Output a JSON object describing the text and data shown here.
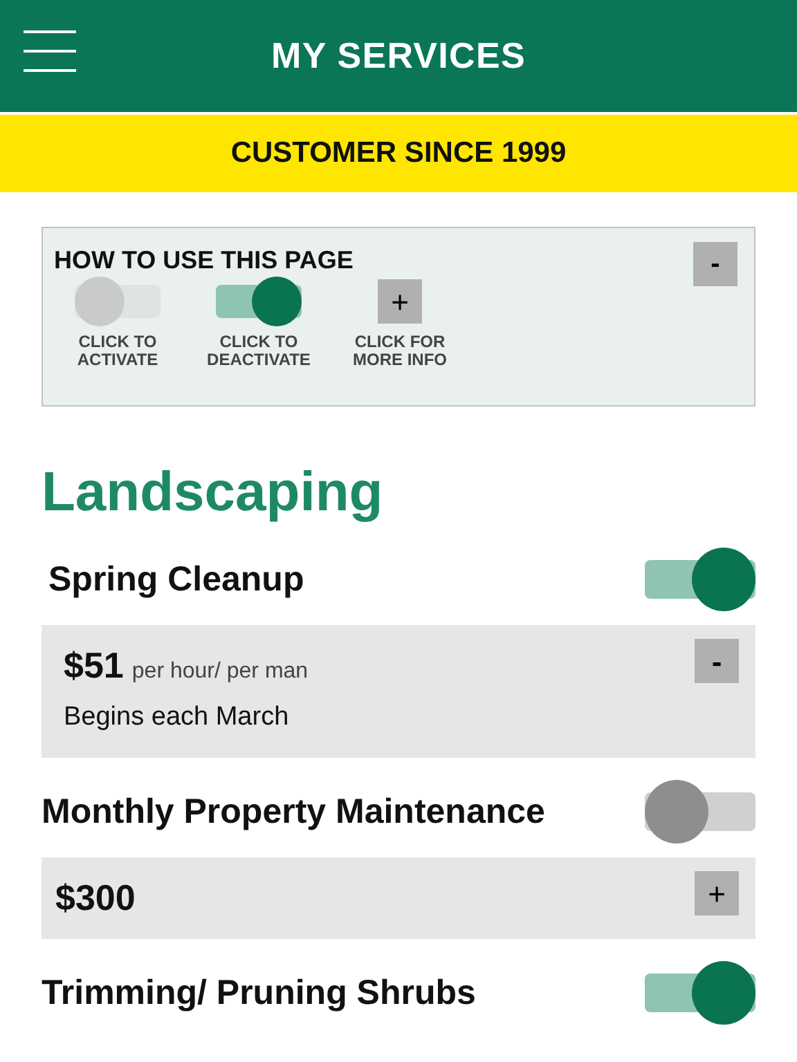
{
  "header": {
    "title": "MY SERVICES"
  },
  "banner": "CUSTOMER SINCE 1999",
  "help": {
    "title": "HOW TO USE THIS PAGE",
    "collapse": "-",
    "legend": [
      {
        "kind": "toggle",
        "on": false,
        "label": "CLICK TO ACTIVATE"
      },
      {
        "kind": "toggle",
        "on": true,
        "label": "CLICK TO DEACTIVATE"
      },
      {
        "kind": "button",
        "symbol": "+",
        "label": "CLICK FOR MORE INFO"
      }
    ]
  },
  "section": {
    "title": "Landscaping",
    "services": [
      {
        "name": "Spring Cleanup",
        "on": true,
        "price": "$51",
        "unit": "per hour/ per man",
        "note": "Begins each March",
        "expanded": true,
        "button": "-"
      },
      {
        "name": "Monthly Property Maintenance",
        "on": false,
        "price": "$300",
        "expanded": false,
        "button": "+"
      },
      {
        "name": "Trimming/ Pruning Shrubs",
        "on": true
      }
    ]
  }
}
